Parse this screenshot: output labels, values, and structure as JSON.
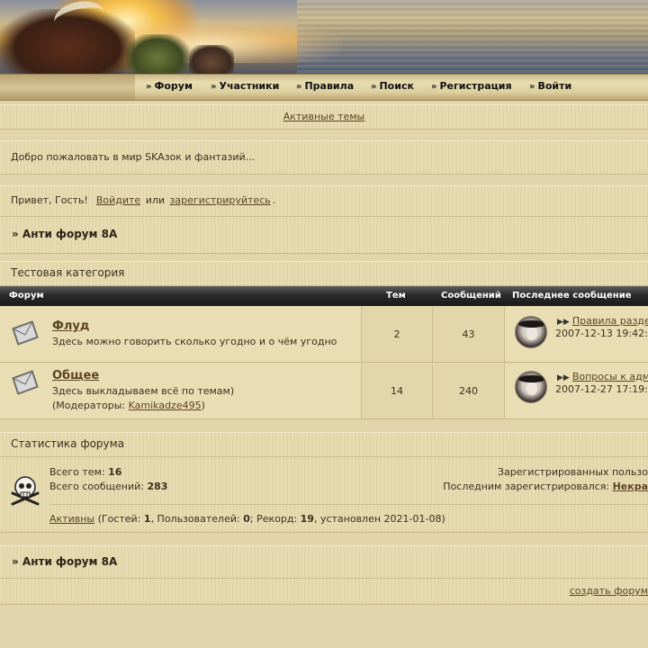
{
  "nav": {
    "items": [
      {
        "label": "Форум"
      },
      {
        "label": "Участники"
      },
      {
        "label": "Правила"
      },
      {
        "label": "Поиск"
      },
      {
        "label": "Регистрация"
      },
      {
        "label": "Войти"
      }
    ]
  },
  "active_topics": "Активные темы",
  "welcome": "Добро пожаловать в мир SKAзок и фантазий...",
  "greeting": {
    "prefix": "Привет, Гость!",
    "login": "Войдите",
    "or": "или",
    "register": "зарегистрируйтесь",
    "suffix": "."
  },
  "breadcrumb": "» Анти форум 8А",
  "category": {
    "title": "Тестовая категория",
    "headers": {
      "forum": "Форум",
      "topics": "Тем",
      "posts": "Сообщений",
      "last_post": "Последнее сообщение"
    },
    "forums": [
      {
        "name": "Флуд",
        "description": "Здесь можно говорить сколько угодно и о чём угодно",
        "topics": "2",
        "posts": "43",
        "last_post_title": "Правила разде",
        "last_post_date": "2007-12-13 19:42:"
      },
      {
        "name": "Общее",
        "description": "Здесь выкладываем всё по темам)",
        "moderators_prefix": "(Модераторы:",
        "moderator": "Kamikadze495",
        "moderators_suffix": ")",
        "topics": "14",
        "posts": "240",
        "last_post_title": "Вопросы к адм",
        "last_post_date": "2007-12-27 17:19:"
      }
    ]
  },
  "stats": {
    "title": "Статистика форума",
    "total_topics_label": "Всего тем:",
    "total_topics": "16",
    "total_posts_label": "Всего сообщений:",
    "total_posts": "283",
    "registered_label": "Зарегистрированных пользо",
    "last_registered_label": "Последним зарегистрировался:",
    "last_registered_user": "Некра",
    "online_link": "Активны",
    "online_text_1": "(Гостей:",
    "guests": "1",
    "online_text_2": ", Пользователей:",
    "users": "0",
    "online_text_3": "; Рекорд:",
    "record": "19",
    "online_text_4": ", установлен 2021-01-08)"
  },
  "footer_breadcrumb": "» Анти форум 8А",
  "create_forum": "создать форум"
}
